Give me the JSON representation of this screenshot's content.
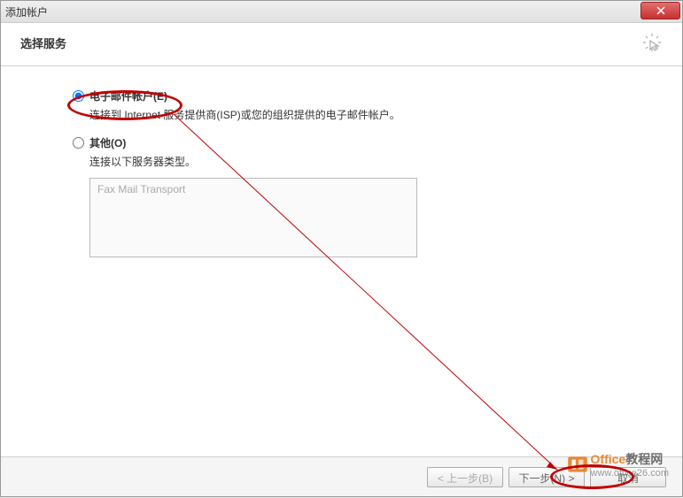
{
  "window": {
    "title": "添加帐户"
  },
  "header": {
    "title": "选择服务"
  },
  "options": {
    "email": {
      "label": "电子邮件帐户(E)",
      "desc": "连接到 Internet 服务提供商(ISP)或您的组织提供的电子邮件帐户。"
    },
    "other": {
      "label": "其他(O)",
      "desc": "连接以下服务器类型。",
      "server_text": "Fax Mail Transport"
    }
  },
  "buttons": {
    "back": "< 上一步(B)",
    "next": "下一步(N) >",
    "cancel": "取消"
  },
  "watermark": {
    "brand_a": "Office",
    "brand_b": "教程网",
    "url": "www.office26.com"
  }
}
